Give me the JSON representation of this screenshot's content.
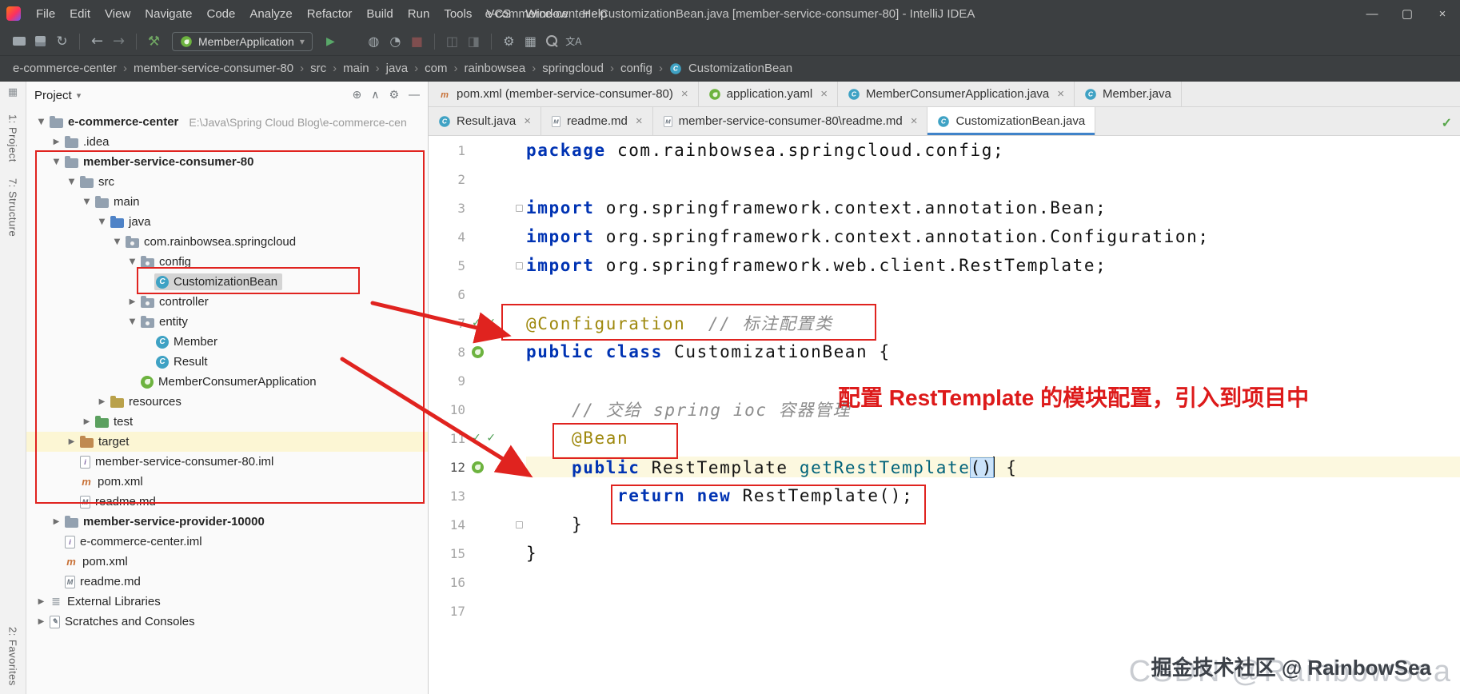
{
  "colors": {
    "chrome_bg": "#3c3f41",
    "accent_red": "#e0231f",
    "tab_active_underline": "#4083c9",
    "keyword_blue": "#0033b3",
    "annotation_olive": "#9e880d",
    "comment_gray": "#8c8c8c",
    "method_teal": "#00627a",
    "run_green": "#59a869"
  },
  "titlebar": {
    "title": "e-commerce-center - CustomizationBean.java [member-service-consumer-80] - IntelliJ IDEA",
    "menu": [
      "File",
      "Edit",
      "View",
      "Navigate",
      "Code",
      "Analyze",
      "Refactor",
      "Build",
      "Run",
      "Tools",
      "VCS",
      "Window",
      "Help"
    ],
    "window_controls": {
      "minimize": "—",
      "maximize": "▢",
      "close": "×"
    }
  },
  "toolbar": {
    "run_config_label": "MemberApplication",
    "left_icons": [
      "open",
      "save",
      "sync",
      "divider",
      "back",
      "forward",
      "divider",
      "hammer"
    ],
    "run_icons": [
      "run",
      "debug",
      "coverage",
      "profiler",
      "stop"
    ],
    "right_icons": [
      "divider",
      "attach1",
      "attach2",
      "divider",
      "gear",
      "grid",
      "search",
      "translate"
    ]
  },
  "icons": {
    "glyphs": {
      "sync": "↻",
      "back": "←",
      "forward": "→",
      "hammer": "⚒",
      "run": "▶",
      "coverage": "◍",
      "profiler": "◔",
      "stop": "■",
      "gear": "⚙",
      "grid": "▦",
      "translate": "文A",
      "attach1": "◫",
      "attach2": "◨",
      "locate": "⊕",
      "collapse": "∧",
      "hide": "―",
      "caret-down": "▾",
      "tree-expanded": "▼",
      "tree-collapsed": "▶",
      "crumb-sep": "›",
      "close": "×",
      "check": "✓",
      "editor-ok": "✓"
    },
    "letters": {
      "class": "C",
      "maven": "m",
      "md": "M",
      "iml": "i",
      "lib": "≣",
      "scratch": "✎",
      "spring": ""
    }
  },
  "breadcrumbs": [
    "e-commerce-center",
    "member-service-consumer-80",
    "src",
    "main",
    "java",
    "com",
    "rainbowsea",
    "springcloud",
    "config",
    "CustomizationBean"
  ],
  "tool_strip": {
    "top": [
      "1: Project",
      "7: Structure"
    ],
    "bottom": [
      "2: Favorites"
    ]
  },
  "project": {
    "header": "Project",
    "header_icons": [
      "locate",
      "collapse",
      "gear",
      "hide"
    ],
    "tree": [
      {
        "label": "e-commerce-center",
        "suffix": "E:\\Java\\Spring Cloud Blog\\e-commerce-cen",
        "level": 0,
        "arrow": "down",
        "icon": "folder",
        "bold": true
      },
      {
        "label": ".idea",
        "level": 1,
        "arrow": "right",
        "icon": "folder"
      },
      {
        "label": "member-service-consumer-80",
        "level": 1,
        "arrow": "down",
        "icon": "folder",
        "bold": true
      },
      {
        "label": "src",
        "level": 2,
        "arrow": "down",
        "icon": "folder"
      },
      {
        "label": "main",
        "level": 3,
        "arrow": "down",
        "icon": "folder"
      },
      {
        "label": "java",
        "level": 4,
        "arrow": "down",
        "icon": "f-java"
      },
      {
        "label": "com.rainbowsea.springcloud",
        "level": 5,
        "arrow": "down",
        "icon": "pkg"
      },
      {
        "label": "config",
        "level": 6,
        "arrow": "down",
        "icon": "pkg"
      },
      {
        "label": "CustomizationBean",
        "level": 7,
        "icon": "class",
        "selected": true
      },
      {
        "label": "controller",
        "level": 6,
        "arrow": "right",
        "icon": "pkg"
      },
      {
        "label": "entity",
        "level": 6,
        "arrow": "down",
        "icon": "pkg"
      },
      {
        "label": "Member",
        "level": 7,
        "icon": "class"
      },
      {
        "label": "Result",
        "level": 7,
        "icon": "class"
      },
      {
        "label": "MemberConsumerApplication",
        "level": 6,
        "icon": "spring"
      },
      {
        "label": "resources",
        "level": 4,
        "arrow": "right",
        "icon": "f-res"
      },
      {
        "label": "test",
        "level": 3,
        "arrow": "right",
        "icon": "f-test"
      },
      {
        "label": "target",
        "level": 2,
        "arrow": "right",
        "icon": "f-target",
        "row_highlight": true
      },
      {
        "label": "member-service-consumer-80.iml",
        "level": 2,
        "icon": "iml"
      },
      {
        "label": "pom.xml",
        "level": 2,
        "icon": "maven"
      },
      {
        "label": "readme.md",
        "level": 2,
        "icon": "md"
      },
      {
        "label": "member-service-provider-10000",
        "level": 1,
        "arrow": "right",
        "icon": "folder",
        "bold": true
      },
      {
        "label": "e-commerce-center.iml",
        "level": 1,
        "icon": "iml"
      },
      {
        "label": "pom.xml",
        "level": 1,
        "icon": "maven"
      },
      {
        "label": "readme.md",
        "level": 1,
        "icon": "md"
      },
      {
        "label": "External Libraries",
        "level": 0,
        "arrow": "right",
        "icon": "lib"
      },
      {
        "label": "Scratches and Consoles",
        "level": 0,
        "arrow": "right",
        "icon": "scratch"
      }
    ]
  },
  "tabs": {
    "row1": [
      {
        "icon": "maven",
        "label": "pom.xml (member-service-consumer-80)",
        "close": true
      },
      {
        "icon": "spring",
        "label": "application.yaml",
        "close": true
      },
      {
        "icon": "class",
        "label": "MemberConsumerApplication.java",
        "close": true
      },
      {
        "icon": "class",
        "label": "Member.java",
        "close": false
      }
    ],
    "row2": [
      {
        "icon": "class",
        "label": "Result.java",
        "close": true
      },
      {
        "icon": "md",
        "label": "readme.md",
        "close": true
      },
      {
        "icon": "md",
        "label": "member-service-consumer-80\\readme.md",
        "close": true
      },
      {
        "icon": "class",
        "label": "CustomizationBean.java",
        "close": false,
        "active": true
      }
    ]
  },
  "editor": {
    "current_line": 12,
    "fold_lines": [
      3,
      5,
      14
    ],
    "gutter_icons": {
      "7": [
        "check",
        "check"
      ],
      "8": [
        "bean"
      ],
      "11": [
        "check",
        "check"
      ],
      "12": [
        "bean"
      ]
    },
    "lines": [
      {
        "num": 1,
        "seg": [
          {
            "c": "kw",
            "t": "package"
          },
          {
            "c": "pl",
            "t": " com.rainbowsea.springcloud.config;"
          }
        ]
      },
      {
        "num": 2,
        "seg": []
      },
      {
        "num": 3,
        "seg": [
          {
            "c": "kw",
            "t": "import"
          },
          {
            "c": "pl",
            "t": " org.springframework.context.annotation.Bean;"
          }
        ]
      },
      {
        "num": 4,
        "seg": [
          {
            "c": "kw",
            "t": "import"
          },
          {
            "c": "pl",
            "t": " org.springframework.context.annotation.Configuration;"
          }
        ]
      },
      {
        "num": 5,
        "seg": [
          {
            "c": "kw",
            "t": "import"
          },
          {
            "c": "pl",
            "t": " org.springframework.web.client.RestTemplate;"
          }
        ]
      },
      {
        "num": 6,
        "seg": []
      },
      {
        "num": 7,
        "seg": [
          {
            "c": "ann",
            "t": "@Configuration"
          },
          {
            "c": "cmt",
            "t": "  // 标注配置类"
          }
        ]
      },
      {
        "num": 8,
        "seg": [
          {
            "c": "kw",
            "t": "public class"
          },
          {
            "c": "pl",
            "t": " CustomizationBean {"
          }
        ]
      },
      {
        "num": 9,
        "seg": []
      },
      {
        "num": 10,
        "seg": [
          {
            "c": "cmt",
            "t": "    // 交给 spring ioc 容器管理"
          }
        ]
      },
      {
        "num": 11,
        "seg": [
          {
            "c": "pl",
            "t": "    "
          },
          {
            "c": "ann",
            "t": "@Bean"
          }
        ]
      },
      {
        "num": 12,
        "seg": [
          {
            "c": "pl",
            "t": "    "
          },
          {
            "c": "kw",
            "t": "public"
          },
          {
            "c": "pl",
            "t": " RestTemplate "
          },
          {
            "c": "mth",
            "t": "getRestTemplate"
          },
          {
            "c": "phl",
            "t": "()"
          },
          {
            "c": "caret",
            "t": ""
          },
          {
            "c": "pl",
            "t": " {"
          }
        ]
      },
      {
        "num": 13,
        "seg": [
          {
            "c": "pl",
            "t": "        "
          },
          {
            "c": "kw",
            "t": "return"
          },
          {
            "c": "pl",
            "t": " "
          },
          {
            "c": "kw",
            "t": "new"
          },
          {
            "c": "pl",
            "t": " RestTemplate();"
          }
        ]
      },
      {
        "num": 14,
        "seg": [
          {
            "c": "pl",
            "t": "    }"
          }
        ]
      },
      {
        "num": 15,
        "seg": [
          {
            "c": "pl",
            "t": "}"
          }
        ]
      },
      {
        "num": 16,
        "seg": []
      },
      {
        "num": 17,
        "seg": []
      }
    ]
  },
  "overlay": {
    "annotation_text": "配置 RestTemplate 的模块配置，引入到项目中",
    "watermark_back": "CSDN @RainbowSea",
    "watermark_front": "掘金技术社区 @ RainbowSea"
  }
}
